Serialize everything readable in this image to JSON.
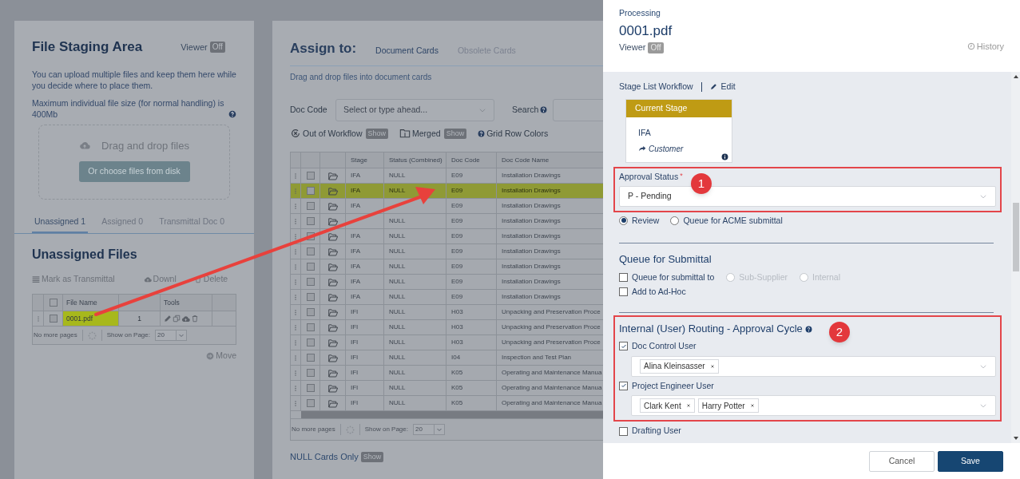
{
  "staging": {
    "title": "File Staging Area",
    "viewer_label": "Viewer",
    "viewer_toggle": "Off",
    "description": "You can upload multiple files and keep them here while you decide where to place them.",
    "max_size": "Maximum individual file size (for normal handling) is 400Mb",
    "dropzone": {
      "text": "Drag and drop files",
      "button": "Or choose files from disk"
    },
    "tabs": [
      {
        "label": "Unassigned 1",
        "selected": true
      },
      {
        "label": "Assigned 0",
        "selected": false
      },
      {
        "label": "Transmittal Doc 0",
        "selected": false
      }
    ],
    "section_title": "Unassigned Files",
    "actions": [
      {
        "kind": "list",
        "label": "Mark as Transmittal"
      },
      {
        "kind": "cloud",
        "label": "Downl"
      },
      {
        "kind": "trash",
        "label": "Delete"
      }
    ],
    "grid": {
      "columns": [
        "File Name",
        "Tools"
      ],
      "select_all_checked": false,
      "rows": [
        {
          "file": "0001.pdf",
          "count": "1",
          "checked": false,
          "highlighted": true
        }
      ]
    },
    "pager": {
      "text": "No more pages",
      "show_label": "Show on Page:",
      "page_size": "20"
    },
    "move": "Move"
  },
  "assign": {
    "title": "Assign to:",
    "tabs": [
      {
        "label": "Document Cards",
        "selected": true
      },
      {
        "label": "Obsolete Cards",
        "selected": false
      }
    ],
    "hint": "Drag and drop files into document cards",
    "doc_code_label": "Doc Code",
    "doc_code_placeholder": "Select or type ahead...",
    "search_label": "Search",
    "toggles": [
      {
        "kind": "workflow",
        "label": "Out of Workflow",
        "button": "Show"
      },
      {
        "kind": "merged",
        "label": "Merged",
        "button": "Show"
      },
      {
        "kind": "help",
        "label": "Grid Row Colors"
      }
    ],
    "grid": {
      "columns": [
        "Stage",
        "Status (Combined)",
        "Doc Code",
        "Doc Code Name"
      ],
      "rows": [
        {
          "stage": "IFA",
          "status": "NULL",
          "code": "E09",
          "name": "Installation Drawings",
          "highlighted": false
        },
        {
          "stage": "IFA",
          "status": "NULL",
          "code": "E09",
          "name": "Installation Drawings",
          "highlighted": true
        },
        {
          "stage": "IFA",
          "code": "E09",
          "name": "Installation Drawings",
          "highlighted": false
        },
        {
          "status": "NULL",
          "code": "E09",
          "name": "Installation Drawings",
          "highlighted": false
        },
        {
          "stage": "IFA",
          "status": "NULL",
          "code": "E09",
          "name": "Installation Drawings",
          "highlighted": false
        },
        {
          "stage": "IFA",
          "status": "NULL",
          "code": "E09",
          "name": "Installation Drawings",
          "highlighted": false
        },
        {
          "stage": "IFA",
          "status": "NULL",
          "code": "E09",
          "name": "Installation Drawings",
          "highlighted": false
        },
        {
          "stage": "IFA",
          "status": "NULL",
          "code": "E09",
          "name": "Installation Drawings",
          "highlighted": false
        },
        {
          "stage": "IFA",
          "status": "NULL",
          "code": "E09",
          "name": "Installation Drawings",
          "highlighted": false
        },
        {
          "stage": "IFI",
          "status": "NULL",
          "code": "H03",
          "name": "Unpacking and Preservation Proce",
          "highlighted": false
        },
        {
          "stage": "IFI",
          "status": "NULL",
          "code": "H03",
          "name": "Unpacking and Preservation Proce",
          "highlighted": false
        },
        {
          "stage": "IFI",
          "status": "NULL",
          "code": "H03",
          "name": "Unpacking and Preservation Proce",
          "highlighted": false
        },
        {
          "stage": "IFI",
          "status": "NULL",
          "code": "I04",
          "name": "Inspection and Test Plan",
          "highlighted": false
        },
        {
          "stage": "IFI",
          "status": "NULL",
          "code": "K05",
          "name": "Operating and Maintenance Manua",
          "highlighted": false
        },
        {
          "stage": "IFI",
          "status": "NULL",
          "code": "K05",
          "name": "Operating and Maintenance Manua",
          "highlighted": false
        },
        {
          "stage": "IFI",
          "status": "NULL",
          "code": "K05",
          "name": "Operating and Maintenance Manua",
          "highlighted": false
        }
      ]
    },
    "pager": {
      "text": "No more pages",
      "show_label": "Show on Page:",
      "page_size": "20"
    },
    "null_cards": {
      "label": "NULL Cards Only",
      "button": "Show"
    }
  },
  "panel": {
    "subtitle": "Processing",
    "title": "0001.pdf",
    "viewer_label": "Viewer",
    "viewer_toggle": "Off",
    "history": "History",
    "workflow_label": "Stage List Workflow",
    "edit": "Edit",
    "stage_card": {
      "header": "Current Stage",
      "stage": "IFA",
      "party": "Customer"
    },
    "approval": {
      "label": "Approval Status",
      "required_mark": "*",
      "value": "P - Pending",
      "badge": "1"
    },
    "radios": [
      {
        "label": "Review",
        "selected": true
      },
      {
        "label": "Queue for ACME submittal",
        "selected": false
      }
    ],
    "queue": {
      "title": "Queue for Submittal",
      "submit_to": {
        "label": "Queue for submittal to",
        "checked": false,
        "options": [
          {
            "label": "Sub-Supplier",
            "selected": false,
            "disabled": true
          },
          {
            "label": "Internal",
            "selected": false,
            "disabled": true
          }
        ]
      },
      "adhoc": {
        "label": "Add to Ad-Hoc",
        "checked": false
      }
    },
    "routing": {
      "title": "Internal (User) Routing - Approval Cycle",
      "badge": "2",
      "users": [
        {
          "label": "Doc Control User",
          "checked": true,
          "tags": [
            "Alina Kleinsasser"
          ]
        },
        {
          "label": "Project Engineer User",
          "checked": true,
          "tags": [
            "Clark Kent",
            "Harry Potter"
          ]
        }
      ],
      "drafting": {
        "label": "Drafting User",
        "checked": false
      }
    },
    "buttons": [
      {
        "kind": "secondary",
        "label": "Cancel"
      },
      {
        "kind": "primary",
        "label": "Save"
      }
    ]
  }
}
